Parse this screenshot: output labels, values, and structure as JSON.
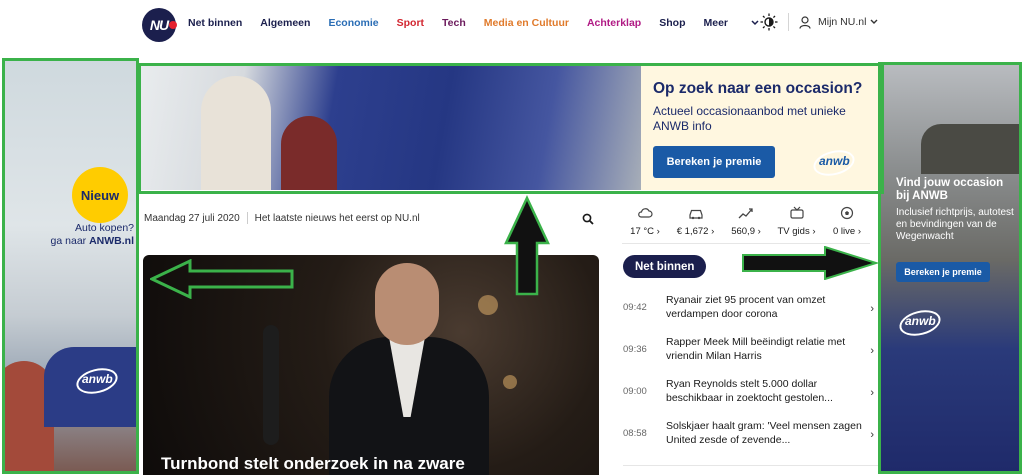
{
  "nav": {
    "logo_text": "NU",
    "items": [
      {
        "label": "Net binnen",
        "color": "#1b1f4d"
      },
      {
        "label": "Algemeen",
        "color": "#1b1f4d"
      },
      {
        "label": "Economie",
        "color": "#2a6db5"
      },
      {
        "label": "Sport",
        "color": "#d22630"
      },
      {
        "label": "Tech",
        "color": "#6b1a5c"
      },
      {
        "label": "Media en Cultuur",
        "color": "#e07a2b"
      },
      {
        "label": "Achterklap",
        "color": "#b01a84"
      },
      {
        "label": "Shop",
        "color": "#1b1f4d"
      },
      {
        "label": "Meer",
        "color": "#1b1f4d"
      }
    ],
    "account_label": "Mijn NU.nl"
  },
  "left_ad": {
    "badge": "Nieuw",
    "line1": "Auto kopen?",
    "line2_prefix": "ga naar ",
    "line2_bold": "ANWB.nl",
    "logo": "anwb"
  },
  "banner_ad": {
    "title": "Op zoek naar een occasion?",
    "subtitle": "Actueel occasionaanbod met unieke ANWB info",
    "cta": "Bereken je premie",
    "logo": "anwb"
  },
  "right_ad": {
    "title": "Vind jouw occasion bij ANWB",
    "subtitle": "Inclusief richtprijs, autotest en bevindingen van de Wegenwacht",
    "cta": "Bereken je premie",
    "logo": "anwb"
  },
  "dateline": {
    "date": "Maandag 27 juli 2020",
    "tagline": "Het laatste nieuws het eerst op NU.nl"
  },
  "widgets": [
    {
      "icon": "cloud-icon",
      "value": "17 °C ›"
    },
    {
      "icon": "car-icon",
      "value": "€ 1,672 ›"
    },
    {
      "icon": "chart-icon",
      "value": "560,9 ›"
    },
    {
      "icon": "tv-icon",
      "value": "TV gids ›"
    },
    {
      "icon": "soccer-icon",
      "value": "0 live ›"
    }
  ],
  "net_binnen": {
    "label": "Net binnen",
    "items": [
      {
        "time": "09:42",
        "title": "Ryanair ziet 95 procent van omzet verdampen door corona"
      },
      {
        "time": "09:36",
        "title": "Rapper Meek Mill beëindigt relatie met vriendin Milan Harris"
      },
      {
        "time": "09:00",
        "title": "Ryan Reynolds stelt 5.000 dollar beschikbaar in zoektocht gestolen..."
      },
      {
        "time": "08:58",
        "title": "Solskjaer haalt gram: 'Veel mensen zagen United zesde of zevende..."
      }
    ]
  },
  "hero": {
    "headline": "Turnbond stelt onderzoek in na zware"
  },
  "colors": {
    "nav_dark": "#1b1f4d",
    "annotation_green": "#3bb24a",
    "cta_blue": "#1a5aa6",
    "badge_yellow": "#ffcc00"
  }
}
